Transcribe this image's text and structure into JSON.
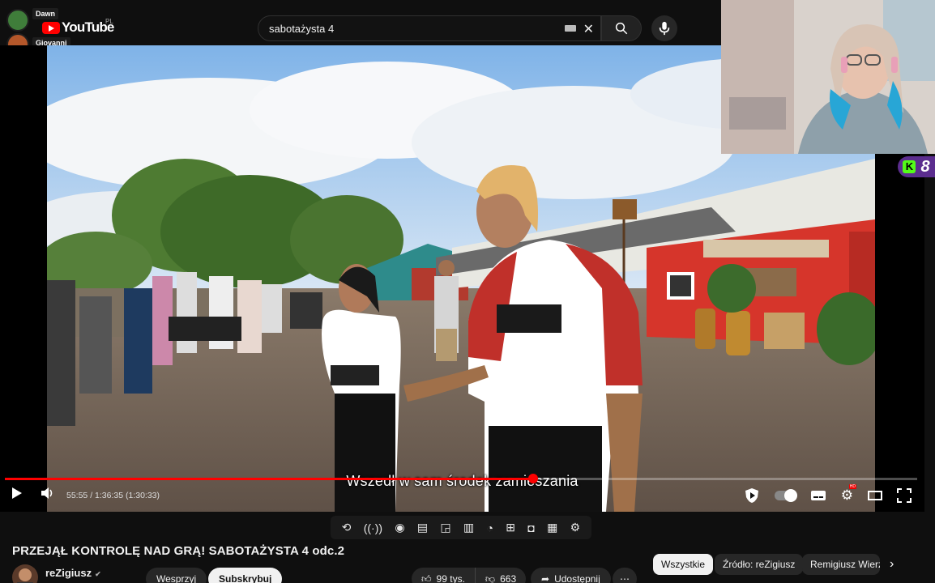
{
  "chat": {
    "users": [
      {
        "name": "Dawn",
        "avatar_color": "#3f7d3a"
      },
      {
        "name": "Giovanni",
        "avatar_color": "#b4572a"
      }
    ]
  },
  "header": {
    "logo_text": "YouTube",
    "region": "PL",
    "search_value": "sabotażysta 4"
  },
  "player": {
    "time_display": "55:55 / 1:36:35 (1:30:33)",
    "progress": 0.579,
    "subtitle": "Wszedł w sam środek zamieszania",
    "hd_badge": "HD"
  },
  "overlay": {
    "kick_letter": "K",
    "kick_count": "8"
  },
  "video": {
    "title": "PRZEJĄŁ KONTROLĘ NAD GRĄ! SABOTAŻYSTA 4 odc.2",
    "channel": "reZigiusz",
    "donate_label": "Wesprzyj",
    "subscribe_label": "Subskrybuj",
    "likes": "99 tys.",
    "dislikes": "663",
    "share_label": "Udostępnij",
    "more_label": "⋯"
  },
  "chips": [
    {
      "label": "Wszystkie",
      "active": true
    },
    {
      "label": "Źródło: reZigiusz",
      "active": false
    },
    {
      "label": "Remigiusz Wierz",
      "active": false
    }
  ],
  "colors": {
    "accent": "#ff0000",
    "background": "#0f0f0f",
    "kick_green": "#53fc18",
    "kick_purple": "#5b2d8e"
  }
}
